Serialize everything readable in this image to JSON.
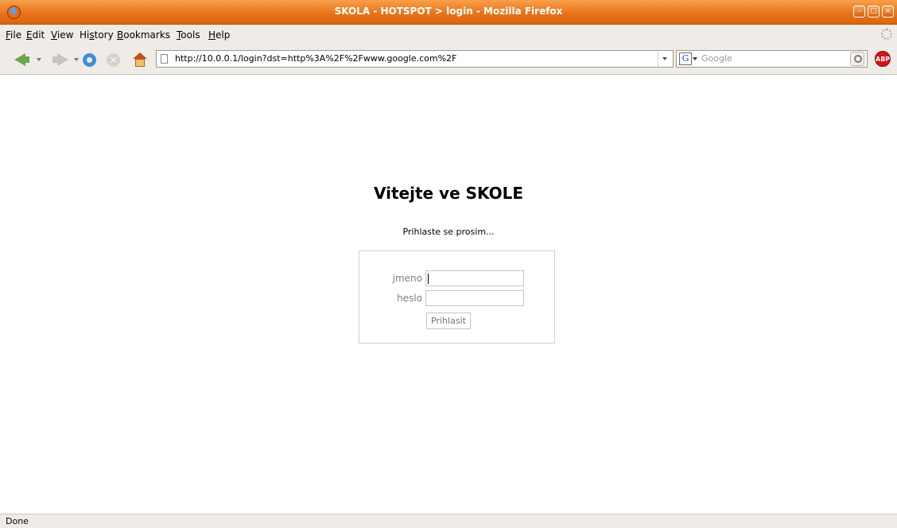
{
  "window": {
    "title": "SKOLA - HOTSPOT > login - Mozilla Firefox"
  },
  "menu": [
    {
      "key": "F",
      "rest": "ile"
    },
    {
      "key": "E",
      "rest": "dit"
    },
    {
      "key": "V",
      "rest": "iew"
    },
    {
      "pre": "Hi",
      "key": "s",
      "rest": "tory"
    },
    {
      "key": "B",
      "rest": "ookmarks"
    },
    {
      "key": "T",
      "rest": "ools"
    },
    {
      "key": "H",
      "rest": "elp"
    }
  ],
  "toolbar": {
    "url": "http://10.0.0.1/login?dst=http%3A%2F%2Fwww.google.com%2F",
    "search_placeholder": "Google",
    "search_engine_icon": "G",
    "adblock_label": "ABP"
  },
  "page": {
    "heading": "Vitejte ve SKOLE",
    "subtitle": "Prihlaste se prosim...",
    "username_label": "jmeno",
    "password_label": "heslo",
    "username_value": "",
    "password_value": "",
    "submit_label": "Prihlasit"
  },
  "status": {
    "text": "Done"
  },
  "colors": {
    "titlebar": "#e8741a",
    "chrome": "#efebe7"
  },
  "icons": [
    "firefox-icon",
    "back-icon",
    "forward-icon",
    "reload-icon",
    "stop-icon",
    "home-icon",
    "page-icon",
    "google-icon",
    "search-icon",
    "adblock-icon",
    "throbber-icon"
  ]
}
